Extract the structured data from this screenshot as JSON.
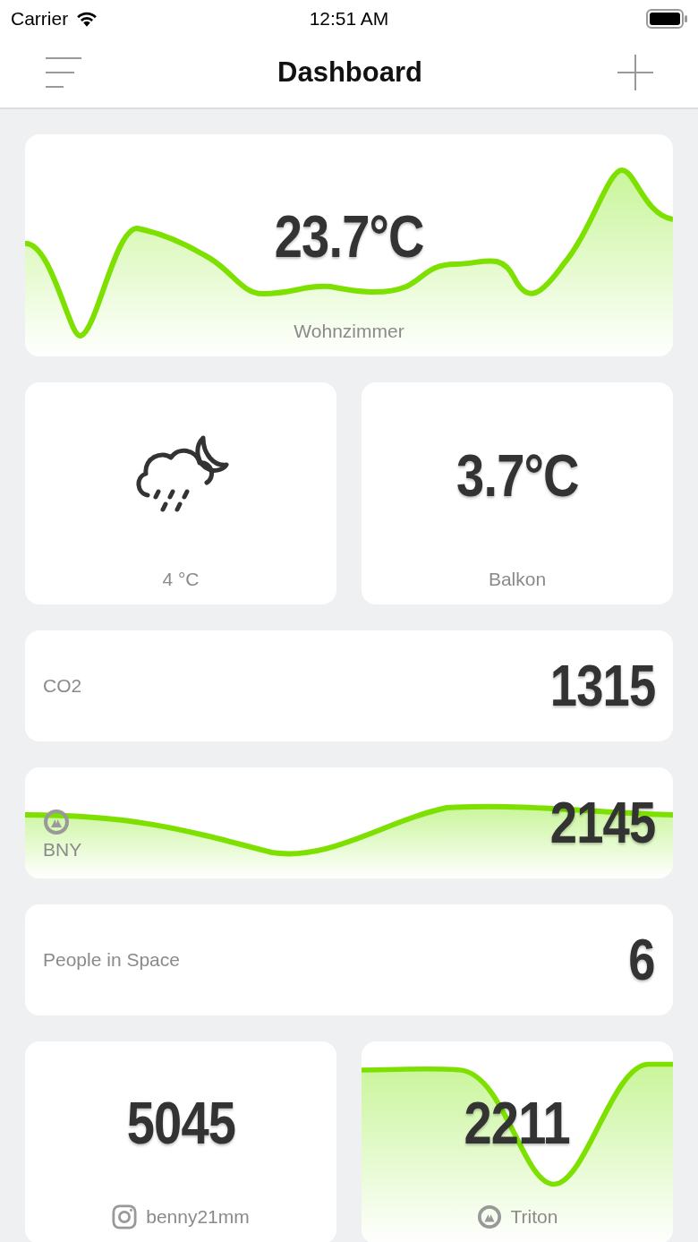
{
  "status_bar": {
    "carrier": "Carrier",
    "time": "12:51 AM"
  },
  "nav": {
    "title": "Dashboard"
  },
  "tiles": [
    {
      "kind": "chart",
      "value": "23.7°C",
      "label": "Wohnzimmer"
    },
    {
      "kind": "weather",
      "label": "4 °C"
    },
    {
      "kind": "value",
      "value": "3.7°C",
      "label": "Balkon"
    },
    {
      "kind": "row",
      "label": "CO2",
      "value": "1315"
    },
    {
      "kind": "row_chart",
      "label": "BNY",
      "value": "2145"
    },
    {
      "kind": "row",
      "label": "People in Space",
      "value": "6"
    },
    {
      "kind": "social",
      "value": "5045",
      "label": "benny21mm"
    },
    {
      "kind": "chart_logo",
      "value": "2211",
      "label": "Triton"
    }
  ]
}
